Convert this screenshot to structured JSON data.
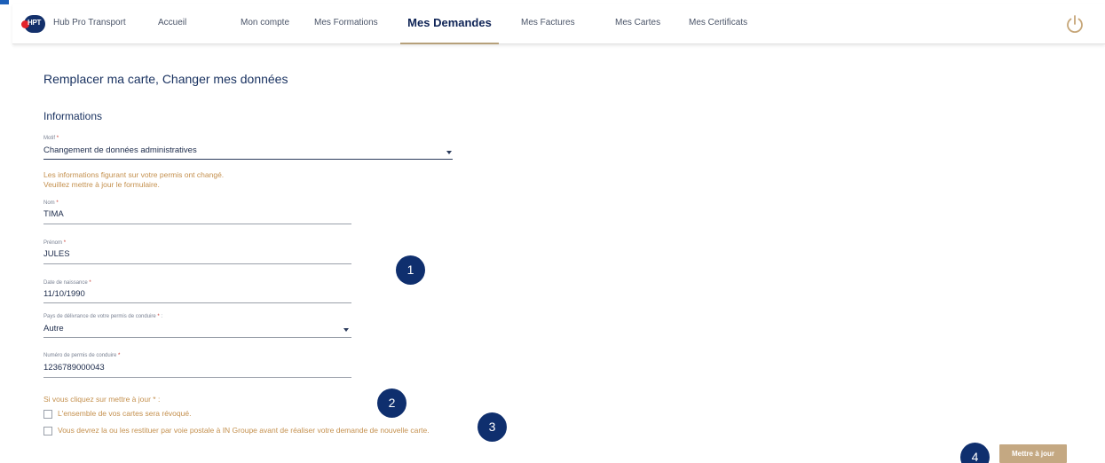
{
  "nav": {
    "brand": "Hub Pro Transport",
    "logo_text": "HPT",
    "items": [
      {
        "label": "Accueil"
      },
      {
        "label": "Mon compte"
      },
      {
        "label": "Mes Formations"
      },
      {
        "label": "Mes Demandes",
        "active": true
      },
      {
        "label": "Mes Factures"
      },
      {
        "label": "Mes Cartes"
      },
      {
        "label": "Mes Certificats"
      }
    ],
    "power_icon": "power-icon"
  },
  "page": {
    "title": "Remplacer ma carte, Changer mes données",
    "section": "Informations"
  },
  "form": {
    "motif": {
      "label": "Motif",
      "required": "*",
      "value": "Changement de données administratives"
    },
    "notice_line1": "Les informations figurant sur votre permis ont changé.",
    "notice_line2": "Veuillez mettre à jour le formulaire.",
    "nom": {
      "label": "Nom",
      "required": "*",
      "value": "TIMA"
    },
    "prenom": {
      "label": "Prénom",
      "required": "*",
      "value": "JULES"
    },
    "naissance": {
      "label": "Date de naissance",
      "required": "*",
      "value": "11/10/1990"
    },
    "pays": {
      "label": "Pays de délivrance de votre permis de conduire",
      "required": "*",
      "suffix": " :",
      "value": "Autre"
    },
    "permis": {
      "label": "Numéro de permis de conduire",
      "required": "*",
      "value": "1236789000043"
    },
    "confirm_title": "Si vous cliquez sur mettre à jour * :",
    "checkbox1": "L'ensemble de vos cartes sera révoqué.",
    "checkbox2": "Vous devrez la ou les restituer par voie postale à IN Groupe avant de réaliser votre demande de nouvelle carte.",
    "submit": "Mettre à jour"
  },
  "badges": {
    "b1": "1",
    "b2": "2",
    "b3": "3",
    "b4": "4"
  },
  "colors": {
    "navy": "#0f2f6e",
    "gold": "#c4a882",
    "warning_text": "#c4904e"
  }
}
